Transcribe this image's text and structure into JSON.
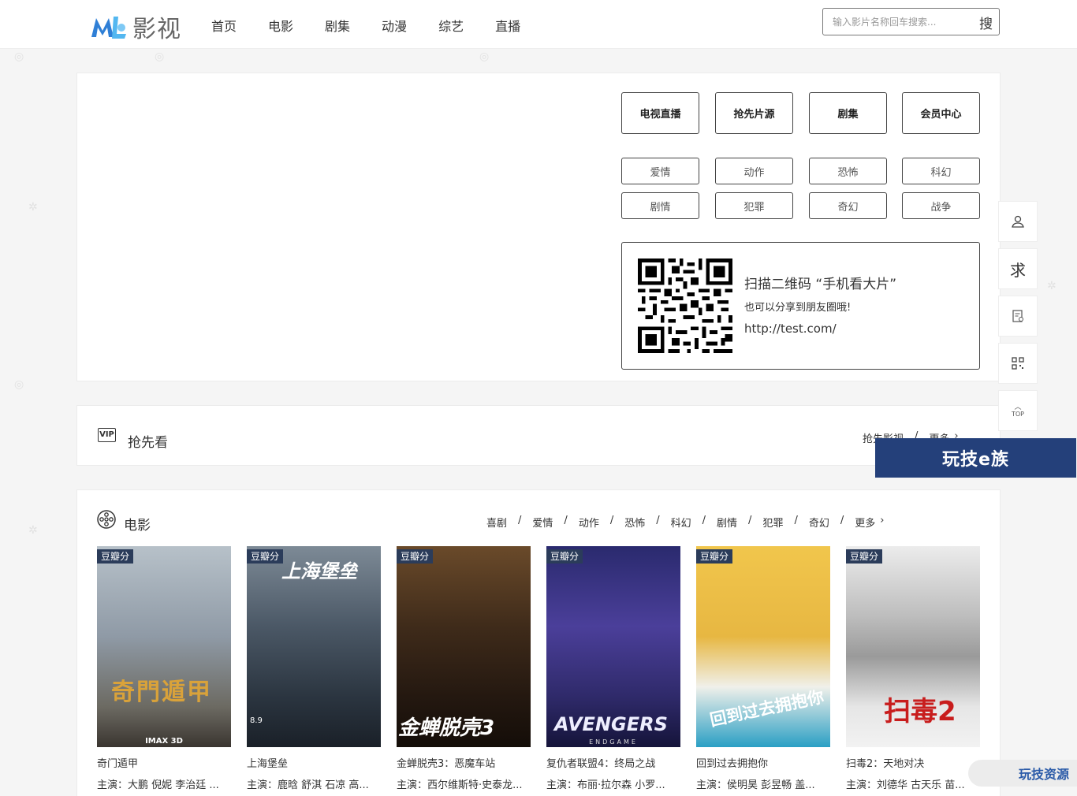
{
  "header": {
    "logo_text": "影视",
    "nav": [
      "首页",
      "电影",
      "剧集",
      "动漫",
      "综艺",
      "直播"
    ],
    "search_placeholder": "输入影片名称回车搜索...",
    "search_button": "搜"
  },
  "hero": {
    "big_buttons": [
      "电视直播",
      "抢先片源",
      "剧集",
      "会员中心"
    ],
    "genre_buttons": [
      "爱情",
      "动作",
      "恐怖",
      "科幻",
      "剧情",
      "犯罪",
      "奇幻",
      "战争"
    ],
    "qr": {
      "title": "扫描二维码 “手机看大片”",
      "subtitle": "也可以分享到朋友圈哦!",
      "url": "http://test.com/"
    }
  },
  "preview_section": {
    "badge": "VIP",
    "title": "抢先看",
    "link1": "抢先影视",
    "sep": "/",
    "more": "更多"
  },
  "movie_section": {
    "title": "电影",
    "filters": [
      "喜剧",
      "爱情",
      "动作",
      "恐怖",
      "科幻",
      "剧情",
      "犯罪",
      "奇幻"
    ],
    "sep": "/",
    "more": "更多",
    "rating_label": "豆瓣分",
    "movies": [
      {
        "title": "奇门遁甲",
        "cast": "主演：大鹏 倪妮 李治廷 ...",
        "poster_text": "奇門遁甲",
        "footer": "IMAX 3D",
        "color": "#8a9aa8"
      },
      {
        "title": "上海堡垒",
        "cast": "主演：鹿晗 舒淇 石凉 高...",
        "poster_text": "上海堡垒",
        "footer": "8.9",
        "color": "#3d4a58"
      },
      {
        "title": "金蝉脱壳3：恶魔车站",
        "cast": "主演：西尔维斯特·史泰龙...",
        "poster_text": "金蝉脱壳3",
        "footer": "",
        "color": "#3a2a1e"
      },
      {
        "title": "复仇者联盟4：终局之战",
        "cast": "主演：布丽·拉尔森 小罗...",
        "poster_text": "AVENGERS",
        "footer": "ENDGAME",
        "color": "#3b3a8c"
      },
      {
        "title": "回到过去拥抱你",
        "cast": "主演：侯明昊 彭昱畅 盖...",
        "poster_text": "回到过去拥抱你",
        "footer": "",
        "color": "#e9b842"
      },
      {
        "title": "扫毒2：天地对决",
        "cast": "主演：刘德华 古天乐 苗...",
        "poster_text": "扫毒2",
        "footer": "",
        "color": "#d9d9d9"
      }
    ]
  },
  "side_toolbar": {
    "items": [
      "user-icon",
      "求",
      "document-icon",
      "qrcode-icon",
      "TOP"
    ]
  },
  "watermarks": {
    "banner": "玩技e族",
    "bottom": "玩技资源"
  }
}
